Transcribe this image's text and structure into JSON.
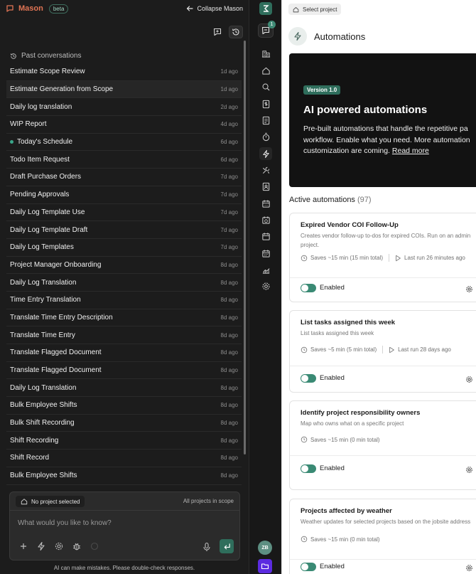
{
  "chat_panel": {
    "brand": "Mason",
    "badge": "beta",
    "collapse_label": "Collapse Mason",
    "past_title": "Past conversations",
    "conversations": [
      {
        "title": "Estimate Scope Review",
        "date": "1d ago"
      },
      {
        "title": "Estimate Generation from Scope",
        "date": "1d ago"
      },
      {
        "title": "Daily log translation",
        "date": "2d ago"
      },
      {
        "title": "WIP Report",
        "date": "4d ago"
      },
      {
        "title": "Today's Schedule",
        "date": "6d ago"
      },
      {
        "title": "Todo Item Request",
        "date": "6d ago"
      },
      {
        "title": "Draft Purchase Orders",
        "date": "7d ago"
      },
      {
        "title": "Pending Approvals",
        "date": "7d ago"
      },
      {
        "title": "Daily Log Template Use",
        "date": "7d ago"
      },
      {
        "title": "Daily Log Template Draft",
        "date": "7d ago"
      },
      {
        "title": "Daily Log Templates",
        "date": "7d ago"
      },
      {
        "title": "Project Manager Onboarding",
        "date": "8d ago"
      },
      {
        "title": "Daily Log Translation",
        "date": "8d ago"
      },
      {
        "title": "Time Entry Translation",
        "date": "8d ago"
      },
      {
        "title": "Translate Time Entry Description",
        "date": "8d ago"
      },
      {
        "title": "Translate Time Entry",
        "date": "8d ago"
      },
      {
        "title": "Translate Flagged Document",
        "date": "8d ago"
      },
      {
        "title": "Translate Flagged Document",
        "date": "8d ago"
      },
      {
        "title": "Daily Log Translation",
        "date": "8d ago"
      },
      {
        "title": "Bulk Employee Shifts",
        "date": "8d ago"
      },
      {
        "title": "Bulk Shift Recording",
        "date": "8d ago"
      },
      {
        "title": "Shift Recording",
        "date": "8d ago"
      },
      {
        "title": "Shift Record",
        "date": "8d ago"
      },
      {
        "title": "Bulk Employee Shifts",
        "date": "8d ago"
      }
    ],
    "composer": {
      "project_chip": "No project selected",
      "scope": "All projects in scope",
      "placeholder": "What would you like to know?"
    },
    "disclaimer": "AI can make mistakes. Please double-check responses."
  },
  "rail": {
    "chat_badge": "1",
    "avatar_initials": "ZB",
    "icons": [
      "buildings-icon",
      "home-icon",
      "search-icon",
      "dollar-doc-icon",
      "document-icon",
      "timer-icon",
      "automation-bolt-icon",
      "tools-icon",
      "contacts-icon",
      "calendar-icon",
      "calendar-clock-icon",
      "calendar-icon-2",
      "calendar-grid-icon",
      "analytics-icon",
      "settings-icon"
    ]
  },
  "automations": {
    "select_project": "Select project",
    "title": "Automations",
    "hero": {
      "version": "Version 1.0",
      "title": "AI powered automations",
      "desc_lines": [
        "Pre-built automations that handle the repetitive pa",
        "workflow. Enable what you need. More automation",
        "customization are coming."
      ],
      "read_more": "Read more"
    },
    "active_label": "Active automations",
    "active_count": "(97)",
    "cards": [
      {
        "title": "Expired Vendor COI Follow-Up",
        "desc": "Creates vendor follow-up to-dos for expired COIs. Run on an admin project.",
        "saves": "Saves ~15 min (15 min total)",
        "last_run": "Last run 26 minutes ago",
        "status": "Enabled"
      },
      {
        "title": "List tasks assigned this week",
        "desc": "List tasks assigned this week",
        "saves": "Saves ~5 min (5 min total)",
        "last_run": "Last run 28 days ago",
        "status": "Enabled"
      },
      {
        "title": "Identify project responsibility owners",
        "desc": "Map who owns what on a specific project",
        "saves": "Saves ~15 min (0 min total)",
        "last_run": "",
        "status": "Enabled"
      },
      {
        "title": "Projects affected by weather",
        "desc": "Weather updates for selected projects based on the jobsite address",
        "saves": "Saves ~15 min (0 min total)",
        "last_run": "",
        "status": "Enabled"
      }
    ]
  },
  "colors": {
    "accent": "#2f6e5c",
    "brand": "#e07454",
    "folder": "#5b2be0"
  }
}
